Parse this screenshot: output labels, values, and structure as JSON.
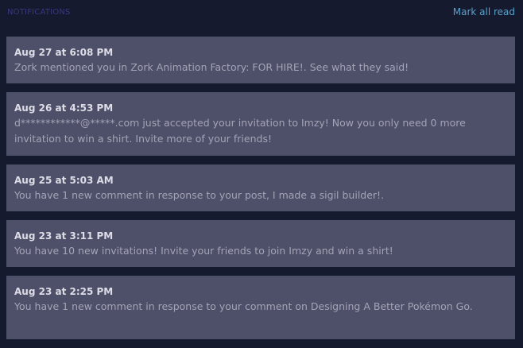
{
  "header": {
    "title": "NOTIFICATIONS",
    "mark_all_label": "Mark all read"
  },
  "notifications": [
    {
      "time": "Aug 27 at 6:08 PM",
      "message": "Zork mentioned you in Zork Animation Factory: FOR HIRE!. See what they said!"
    },
    {
      "time": "Aug 26 at 4:53 PM",
      "message": "d************@*****.com just accepted your invitation to Imzy! Now you only need 0 more invitation to win a shirt. Invite more of your friends!"
    },
    {
      "time": "Aug 25 at 5:03 AM",
      "message": "You have 1 new comment in response to your post, I made a sigil builder!."
    },
    {
      "time": "Aug 23 at 3:11 PM",
      "message": "You have 10 new invitations! Invite your friends to join Imzy and win a shirt!"
    },
    {
      "time": "Aug 23 at 2:25 PM",
      "message": "You have 1 new comment in response to your comment on Designing A Better Pokémon Go."
    }
  ]
}
